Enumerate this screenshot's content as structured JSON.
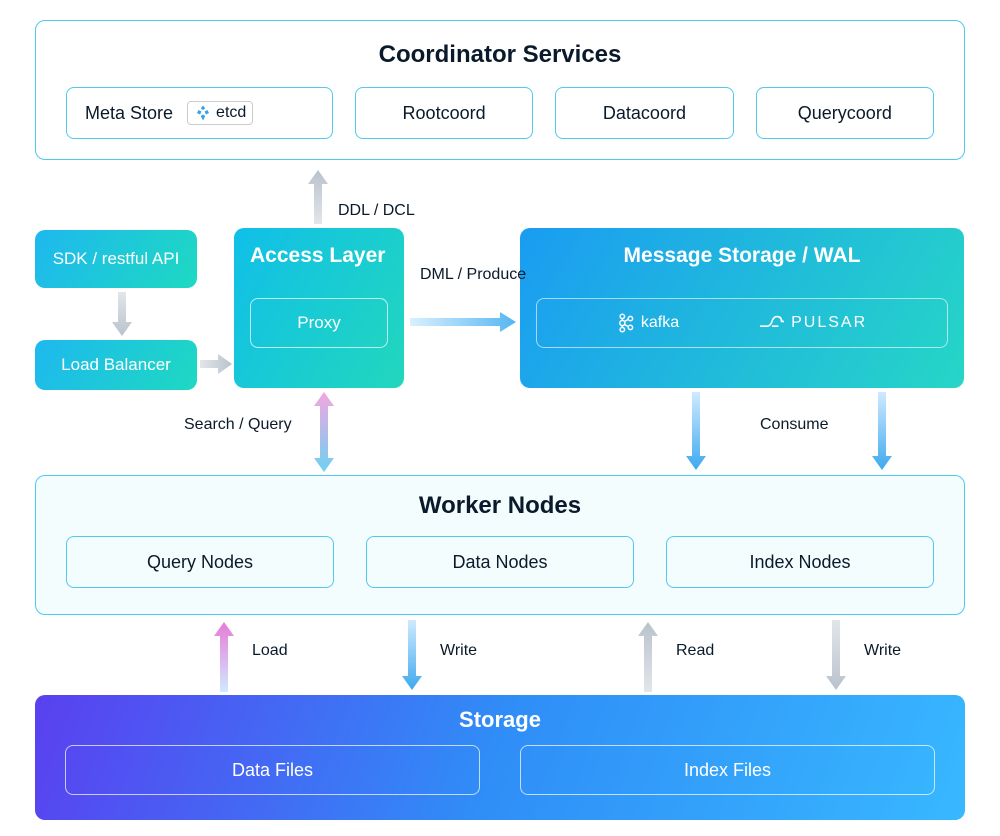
{
  "coordinator": {
    "title": "Coordinator Services",
    "items": {
      "meta": "Meta Store",
      "etcd": "etcd",
      "root": "Rootcoord",
      "data": "Datacoord",
      "query": "Querycoord"
    }
  },
  "sdk": {
    "label": "SDK / restful API"
  },
  "lb": {
    "label": "Load Balancer"
  },
  "access": {
    "title": "Access Layer",
    "proxy": "Proxy"
  },
  "wal": {
    "title": "Message Storage / WAL",
    "kafka": "kafka",
    "pulsar": "PULSAR"
  },
  "worker": {
    "title": "Worker Nodes",
    "query": "Query Nodes",
    "data": "Data Nodes",
    "index": "Index Nodes"
  },
  "storage": {
    "title": "Storage",
    "data": "Data Files",
    "index": "Index Files"
  },
  "labels": {
    "ddl": "DDL / DCL",
    "dml": "DML / Produce",
    "search": "Search / Query",
    "consume": "Consume",
    "load": "Load",
    "write1": "Write",
    "read": "Read",
    "write2": "Write"
  }
}
